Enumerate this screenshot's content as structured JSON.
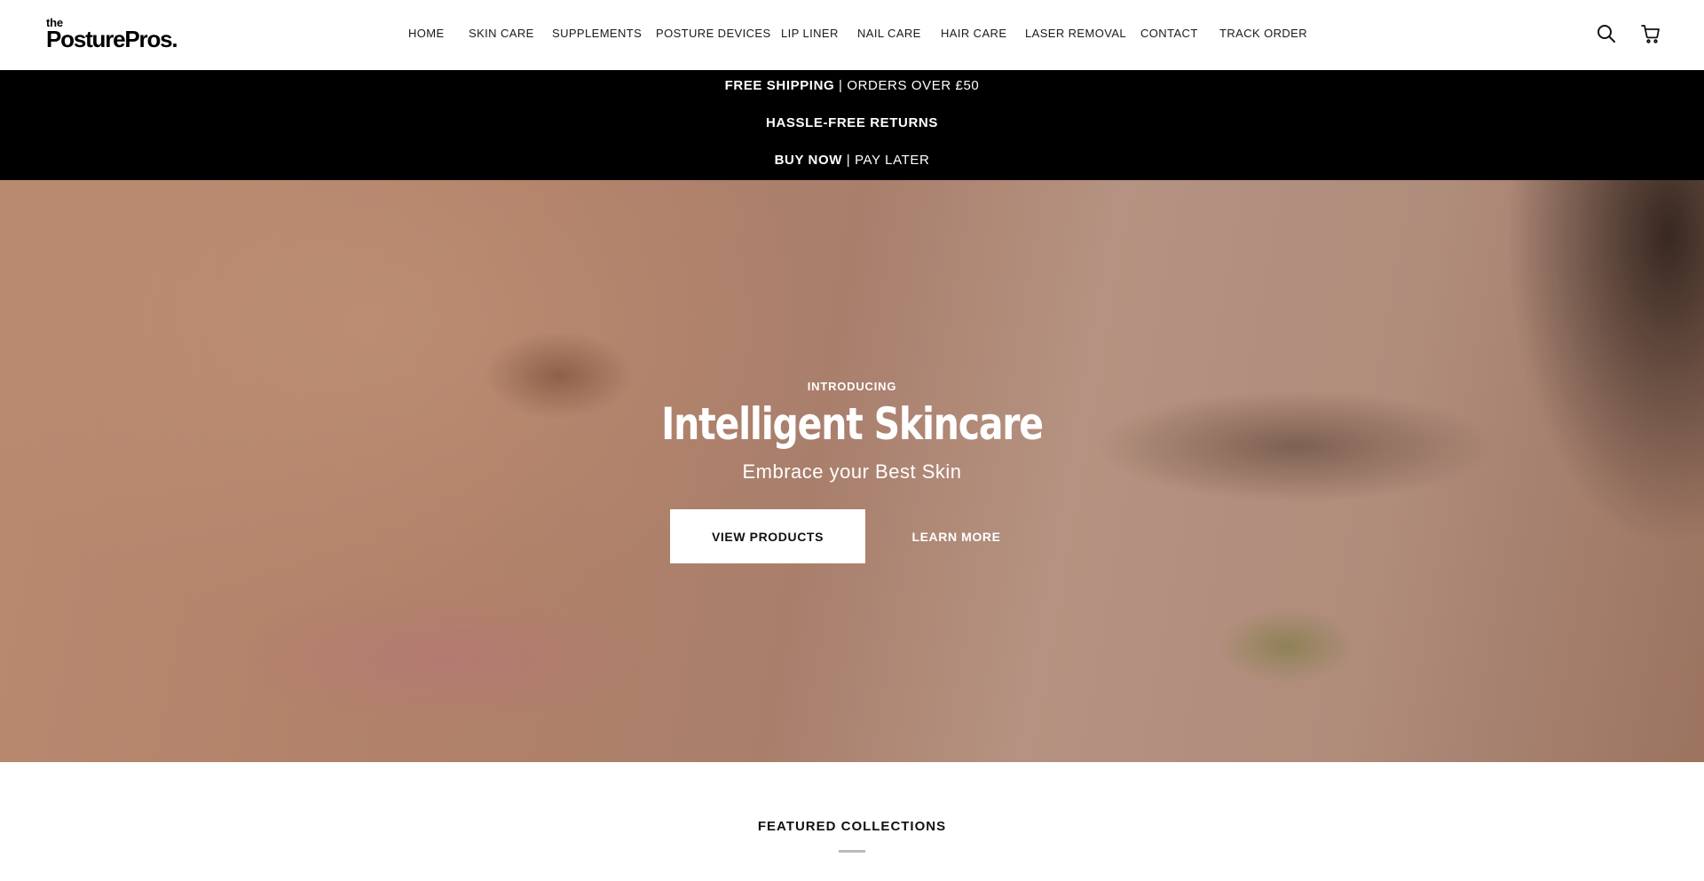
{
  "header": {
    "logo_top": "the",
    "logo_main": "PosturePros.",
    "nav": [
      {
        "label": "HOME"
      },
      {
        "label": "SKIN CARE"
      },
      {
        "label": "SUPPLEMENTS"
      },
      {
        "label": "POSTURE DEVICES"
      },
      {
        "label": "LIP LINER"
      },
      {
        "label": "NAIL CARE"
      },
      {
        "label": "HAIR CARE"
      },
      {
        "label": "LASER REMOVAL"
      },
      {
        "label": "CONTACT"
      },
      {
        "label": "TRACK ORDER"
      }
    ],
    "icons": {
      "search": "search-icon",
      "cart": "cart-icon"
    }
  },
  "announcement": {
    "line1_bold": "FREE SHIPPING",
    "line1_rest": " | ORDERS OVER £50",
    "line2_bold": "HASSLE-FREE RETURNS",
    "line3_bold": "BUY NOW",
    "line3_rest": " | PAY LATER"
  },
  "hero": {
    "eyebrow": "INTRODUCING",
    "title": "Intelligent Skincare",
    "subtitle": "Embrace your Best Skin",
    "primary_button": "VIEW PRODUCTS",
    "secondary_button": "LEARN MORE"
  },
  "featured": {
    "title": "FEATURED COLLECTIONS"
  },
  "colors": {
    "announcement_bg": "#000000",
    "button_bg": "#ffffff",
    "text": "#111111"
  }
}
